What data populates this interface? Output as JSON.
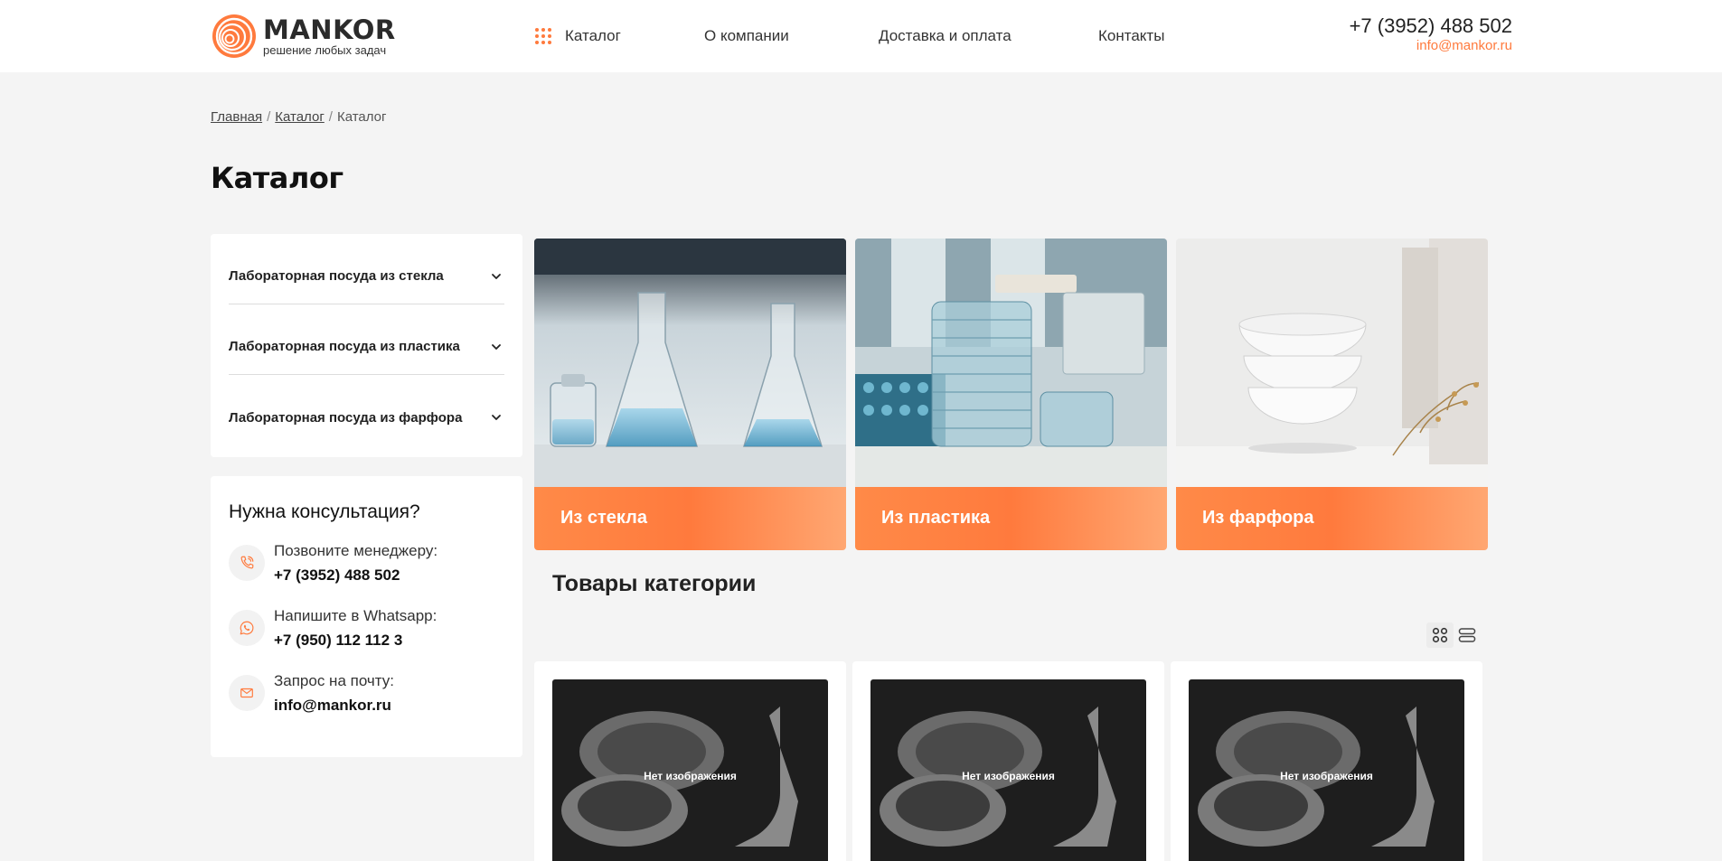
{
  "header": {
    "logo_name": "MANKOR",
    "logo_tagline": "решение любых задач",
    "nav": [
      "Каталог",
      "О компании",
      "Доставка и оплата",
      "Контакты"
    ],
    "phone": "+7 (3952) 488 502",
    "email": "info@mankor.ru",
    "accent": "#ff7a3d"
  },
  "breadcrumb": [
    "Главная",
    "Каталог",
    "Каталог"
  ],
  "page_title": "Каталог",
  "sidebar": {
    "categories": [
      "Лабораторная посуда из стекла",
      "Лабораторная посуда из пластика",
      "Лабораторная посуда из фарфора"
    ]
  },
  "consult": {
    "title": "Нужна консультация?",
    "items": [
      {
        "label": "Позвоните менеджеру:",
        "value": "+7 (3952) 488 502",
        "icon": "phone-icon"
      },
      {
        "label": "Напишите в Whatsapp:",
        "value": "+7 (950) 112 112 3",
        "icon": "whatsapp-icon"
      },
      {
        "label": "Запрос на почту:",
        "value": "info@mankor.ru",
        "icon": "mail-icon"
      }
    ]
  },
  "category_cards": [
    "Из стекла",
    "Из пластика",
    "Из фарфора"
  ],
  "products": {
    "title": "Товары категории",
    "no_image_label": "Нет изображения",
    "view_modes": [
      "grid-view-icon",
      "list-view-icon"
    ]
  }
}
